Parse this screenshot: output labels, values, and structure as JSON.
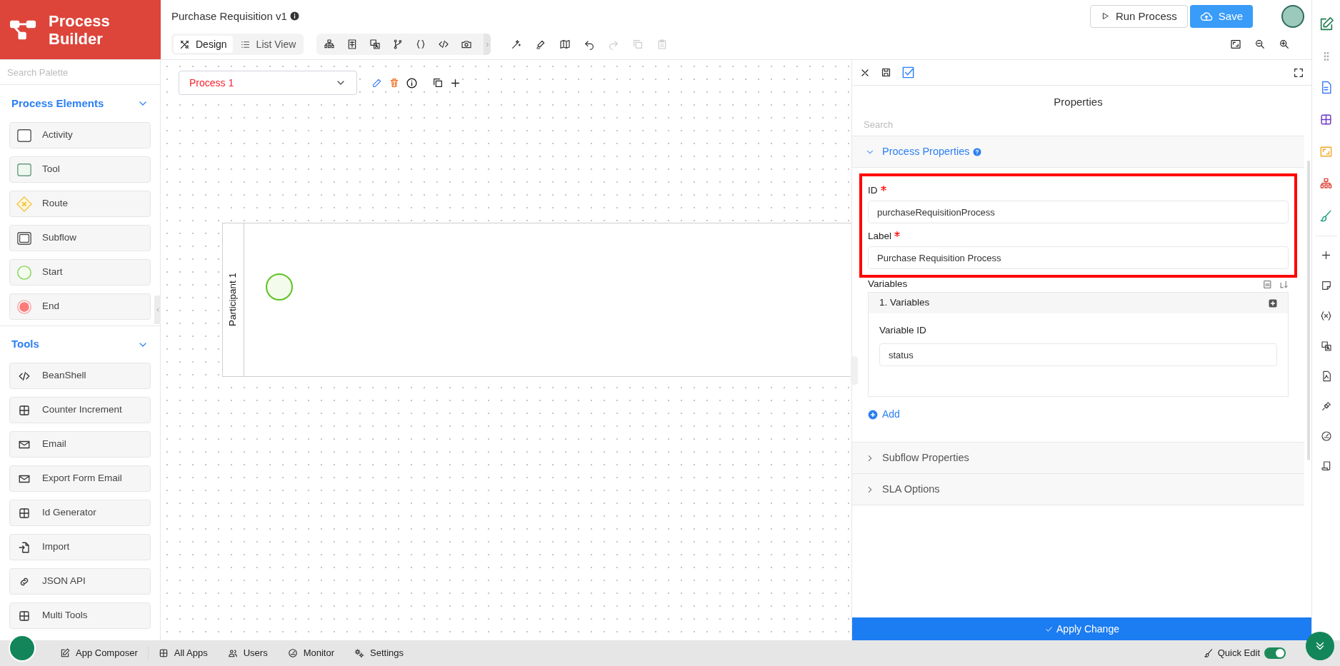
{
  "app": {
    "title": "Process Builder"
  },
  "document": {
    "title": "Purchase Requisition v1"
  },
  "view_tabs": [
    {
      "label": "Design",
      "kind": "design",
      "selected": true
    },
    {
      "label": "List View",
      "kind": "list",
      "selected": false
    }
  ],
  "edit_tools": [
    {
      "kind": "wand",
      "disabled": false
    },
    {
      "kind": "highlighter",
      "disabled": false
    },
    {
      "kind": "map",
      "disabled": false
    },
    {
      "kind": "undo",
      "disabled": false
    },
    {
      "kind": "redo",
      "disabled": true
    },
    {
      "kind": "copy",
      "disabled": true
    },
    {
      "kind": "paste",
      "disabled": true
    }
  ],
  "header_buttons": [
    {
      "label": "Run Process",
      "kind": "run"
    },
    {
      "label": "Save",
      "kind": "save"
    }
  ],
  "palette": {
    "search_placeholder": "Search Palette",
    "sections": [
      {
        "title": "Process Elements",
        "expanded": true,
        "items": [
          {
            "label": "Activity",
            "kind": "activity"
          },
          {
            "label": "Tool",
            "kind": "tool"
          },
          {
            "label": "Route",
            "kind": "route"
          },
          {
            "label": "Subflow",
            "kind": "subflow"
          },
          {
            "label": "Start",
            "kind": "start"
          },
          {
            "label": "End",
            "kind": "end"
          }
        ]
      },
      {
        "title": "Tools",
        "expanded": true,
        "items": [
          {
            "label": "BeanShell",
            "kind": "code"
          },
          {
            "label": "Counter Increment",
            "kind": "grid"
          },
          {
            "label": "Email",
            "kind": "mail"
          },
          {
            "label": "Export Form Email",
            "kind": "mail"
          },
          {
            "label": "Id Generator",
            "kind": "grid"
          },
          {
            "label": "Import",
            "kind": "import"
          },
          {
            "label": "JSON API",
            "kind": "link"
          },
          {
            "label": "Multi Tools",
            "kind": "grid"
          }
        ]
      }
    ]
  },
  "canvas": {
    "process": "Process 1",
    "participant": "Participant 1"
  },
  "properties": {
    "title": "Properties",
    "search_placeholder": "Search",
    "sections": [
      {
        "title": "Process Properties",
        "expanded": true
      },
      {
        "title": "Subflow Properties",
        "expanded": false
      },
      {
        "title": "SLA Options",
        "expanded": false
      }
    ],
    "fields": [
      {
        "label": "ID",
        "required": true,
        "value": "purchaseRequisitionProcess"
      },
      {
        "label": "Label",
        "required": true,
        "value": "Purchase Requisition Process"
      }
    ],
    "variables": {
      "label": "Variables",
      "group_title": "1. Variables",
      "field_label": "Variable ID",
      "field_value": "status",
      "add_label": "Add"
    },
    "apply_button": "Apply Change"
  },
  "bottom_bar": {
    "links": [
      {
        "label": "App Composer",
        "kind": "edit"
      },
      {
        "label": "All Apps",
        "kind": "grid"
      },
      {
        "label": "Users",
        "kind": "users"
      },
      {
        "label": "Monitor",
        "kind": "gauge"
      },
      {
        "label": "Settings",
        "kind": "gears"
      }
    ],
    "quick_edit": {
      "label": "Quick Edit",
      "on": true
    }
  }
}
